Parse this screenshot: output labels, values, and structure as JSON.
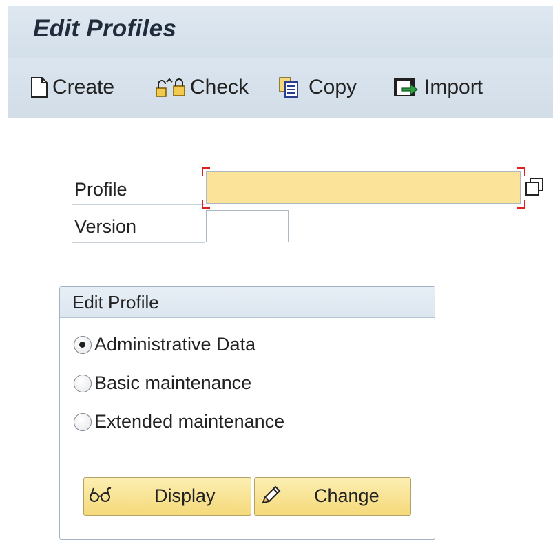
{
  "window": {
    "title": "Edit Profiles"
  },
  "toolbar": {
    "create_label": "Create",
    "check_label": "Check",
    "copy_label": "Copy",
    "import_label": "Import"
  },
  "form": {
    "profile_label": "Profile",
    "profile_value": "",
    "version_label": "Version",
    "version_value": ""
  },
  "group": {
    "title": "Edit Profile",
    "options": [
      {
        "label": "Administrative Data",
        "checked": true
      },
      {
        "label": "Basic maintenance",
        "checked": false
      },
      {
        "label": "Extended maintenance",
        "checked": false
      }
    ],
    "display_label": "Display",
    "change_label": "Change"
  },
  "colors": {
    "required_field": "#fbe49a",
    "button_fill": "#f5d97a",
    "header_bg": "#d6e1ec",
    "required_marker": "#e02020"
  },
  "icons": {
    "create": "blank-document-icon",
    "check": "check-objects-icon",
    "copy": "copy-documents-icon",
    "import": "import-icon",
    "value_help": "value-help-icon",
    "display": "glasses-icon",
    "change": "pencil-icon"
  }
}
